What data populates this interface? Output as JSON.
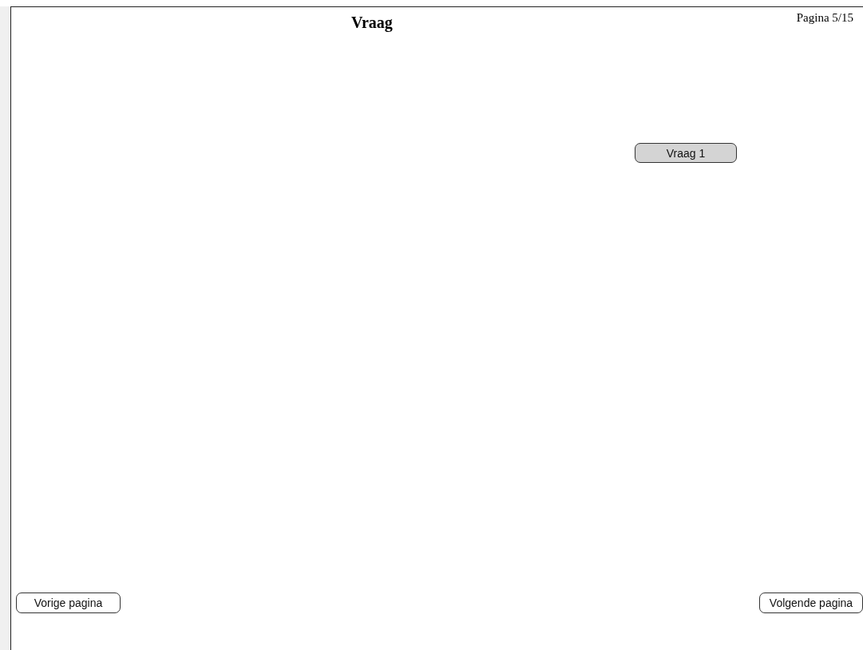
{
  "title": "Vraag",
  "page_indicator": "Pagina 5/15",
  "question_buttons": [
    {
      "label": "Vraag 1",
      "selected": true
    }
  ],
  "nav": {
    "previous": "Vorige pagina",
    "next": "Volgende pagina"
  }
}
